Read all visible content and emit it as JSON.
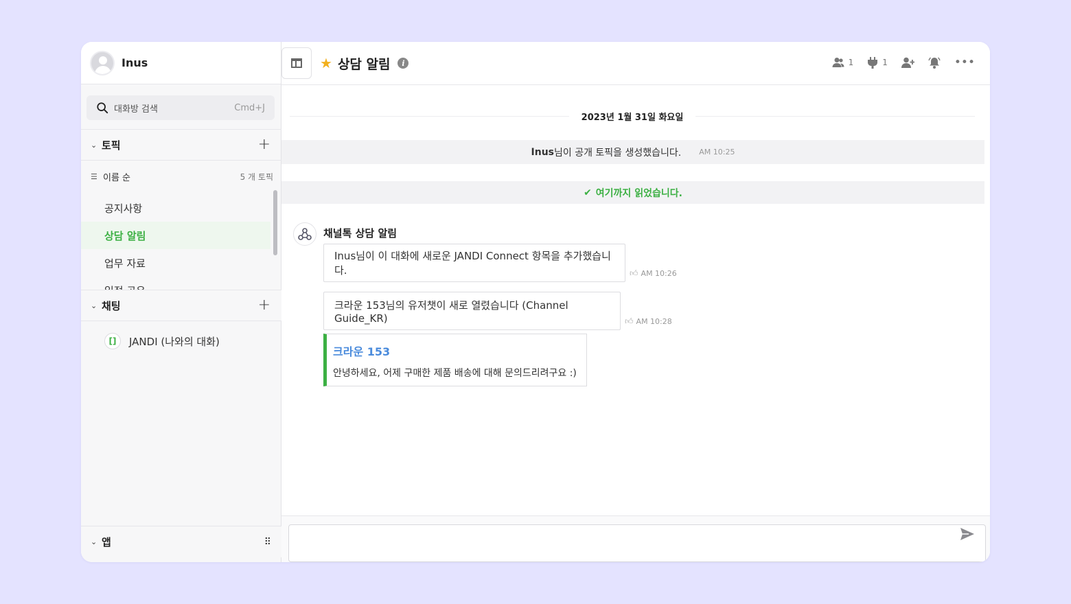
{
  "profile": {
    "name": "Inus"
  },
  "search": {
    "placeholder": "대화방 검색",
    "shortcut": "Cmd+J"
  },
  "topics": {
    "title": "토픽",
    "sort_label": "이름 순",
    "count_label": "5 개 토픽",
    "items": [
      {
        "label": "공지사항",
        "active": false
      },
      {
        "label": "상담 알림",
        "active": true
      },
      {
        "label": "업무 자료",
        "active": false
      },
      {
        "label": "일정 공유",
        "active": false
      }
    ]
  },
  "chats": {
    "title": "채팅",
    "items": [
      {
        "label": "JANDI (나와의 대화)"
      }
    ]
  },
  "apps": {
    "title": "앱"
  },
  "header": {
    "room_title": "상담 알림",
    "members_count": "1",
    "connect_count": "1"
  },
  "feed": {
    "date": "2023년 1월 31일 화요일",
    "system_message": {
      "user": "Inus",
      "text": " 님이 공개 토픽을 생성했습니다.",
      "time": "AM 10:25"
    },
    "read_marker": "여기까지 읽었습니다.",
    "bot_name": "채널톡 상담 알림",
    "messages": [
      {
        "text": "Inus님이 이 대화에 새로운 JANDI Connect 항목을 추가했습니다.",
        "time": "AM 10:26"
      },
      {
        "text": "크라운 153님의 유저챗이 새로 열렸습니다 (Channel Guide_KR)",
        "time": "AM 10:28"
      }
    ],
    "card": {
      "title": "크라운 153",
      "body": "안녕하세요, 어제 구매한 제품 배송에 대해 문의드리려구요 :)"
    }
  },
  "colors": {
    "accent": "#3cb043",
    "link": "#4a8bdc",
    "background": "#e4e3ff",
    "star": "#f2b01e"
  }
}
